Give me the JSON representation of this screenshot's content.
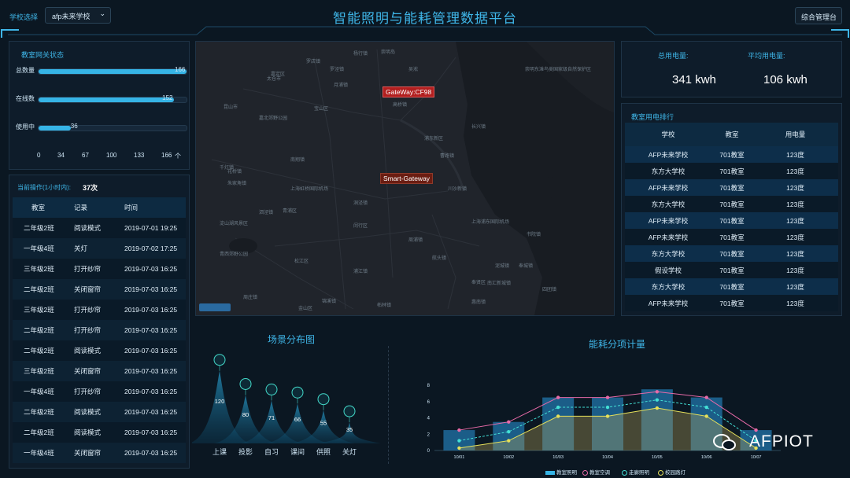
{
  "header": {
    "school_label": "学校选择",
    "school_select": "afp未来学校",
    "title": "智能照明与能耗管理数据平台",
    "admin_button": "综合管理台"
  },
  "gateway_status": {
    "title": "教室网关状态",
    "bars": [
      {
        "label": "总数量",
        "value": 166,
        "fraction": 1.0
      },
      {
        "label": "在线数",
        "value": 152,
        "fraction": 0.9157
      },
      {
        "label": "使用中",
        "value": 36,
        "fraction": 0.2169
      }
    ],
    "ticks": [
      "0",
      "34",
      "67",
      "100",
      "133",
      "166"
    ],
    "unit": "个"
  },
  "operations": {
    "label": "当前操作(1小时内):",
    "count": "37次",
    "columns": [
      "教室",
      "记录",
      "时间"
    ],
    "rows": [
      [
        "二年级2班",
        "阅读模式",
        "2019-07-01 19:25"
      ],
      [
        "一年级4班",
        "关灯",
        "2019-07-02 17:25"
      ],
      [
        "三年级2班",
        "打开纱帘",
        "2019-07-03 16:25"
      ],
      [
        "二年级2班",
        "关闭窗帘",
        "2019-07-03 16:25"
      ],
      [
        "三年级2班",
        "打开纱帘",
        "2019-07-03 16:25"
      ],
      [
        "二年级2班",
        "打开纱帘",
        "2019-07-03 16:25"
      ],
      [
        "二年级2班",
        "阅读模式",
        "2019-07-03 16:25"
      ],
      [
        "三年级2班",
        "关闭窗帘",
        "2019-07-03 16:25"
      ],
      [
        "一年级4班",
        "打开纱帘",
        "2019-07-03 16:25"
      ],
      [
        "二年级2班",
        "阅读模式",
        "2019-07-03 16:25"
      ],
      [
        "二年级2班",
        "阅读模式",
        "2019-07-03 16:25"
      ],
      [
        "一年级4班",
        "关闭窗帘",
        "2019-07-03 16:25"
      ]
    ]
  },
  "map": {
    "gateways": [
      "GateWay:CF98",
      "Smart-Gateway"
    ],
    "labels": [
      "嘉定区",
      "宝山区",
      "太仓市",
      "罗泾镇",
      "月浦镇",
      "昆山市",
      "青浦区",
      "嘉北郊野公园",
      "长兴镇",
      "千灯镇",
      "松江区",
      "闵行区",
      "奉贤区",
      "崇明岛",
      "崇明东滩鸟类国家级自然保护区",
      "上海虹桥国际机场",
      "上海浦东国际机场",
      "金山区",
      "浦东新区",
      "朱家角镇",
      "淀山湖风景区",
      "洞泾镇",
      "青西郊野公园",
      "泗泾镇",
      "川沙新镇",
      "周浦镇",
      "南汇新城镇",
      "惠南镇",
      "浦江镇",
      "吴淞",
      "高桥镇",
      "花桥镇",
      "周庄镇",
      "锦溪镇",
      "罗店镇",
      "杨行镇",
      "南翔镇",
      "曹路镇",
      "航头镇",
      "奉城镇",
      "柘林镇",
      "书院镇",
      "四团镇",
      "泥城镇"
    ]
  },
  "kpi": {
    "total_label": "总用电量:",
    "total_value": "341 kwh",
    "avg_label": "平均用电量:",
    "avg_value": "106 kwh"
  },
  "ranking": {
    "title": "教室用电排行",
    "columns": [
      "学校",
      "教室",
      "用电量"
    ],
    "rows": [
      [
        "AFP未来学校",
        "701教室",
        "123度"
      ],
      [
        "东方大学校",
        "701教室",
        "123度"
      ],
      [
        "AFP未来学校",
        "701教室",
        "123度"
      ],
      [
        "东方大学校",
        "701教室",
        "123度"
      ],
      [
        "AFP未来学校",
        "701教室",
        "123度"
      ],
      [
        "AFP未来学校",
        "701教室",
        "123度"
      ],
      [
        "东方大学校",
        "701教室",
        "123度"
      ],
      [
        "假设学校",
        "701教室",
        "123度"
      ],
      [
        "东方大学校",
        "701教室",
        "123度"
      ],
      [
        "AFP未来学校",
        "701教室",
        "123度"
      ]
    ]
  },
  "colors": {
    "accent": "#3fb6e8",
    "bar": "#36b4e6",
    "pink": "#e86aa8",
    "cyan": "#43e0d6",
    "yellow": "#e6e05a",
    "gold": "#b8a35a"
  },
  "chart_data": [
    {
      "type": "area",
      "title": "场景分布图",
      "categories": [
        "上课",
        "投影",
        "自习",
        "课间",
        "供照",
        "关灯"
      ],
      "values": [
        120,
        80,
        71,
        66,
        55,
        35
      ],
      "icons": [
        "screen-icon",
        "projector-icon",
        "book-icon",
        "moon-icon",
        "lamp-icon",
        "power-icon"
      ]
    },
    {
      "type": "bar",
      "title": "能耗分项计量",
      "categories": [
        "10/01",
        "10/02",
        "10/03",
        "10/04",
        "10/05",
        "10/06",
        "10/07"
      ],
      "ylim": [
        0,
        8
      ],
      "yticks": [
        "0",
        "2",
        "4",
        "6",
        "8"
      ],
      "series": [
        {
          "name": "教室照明",
          "kind": "bar",
          "values": [
            2.5,
            3.5,
            6.5,
            6.5,
            7.5,
            6.5,
            2.5
          ]
        },
        {
          "name": "教室空调",
          "kind": "line",
          "values": [
            2.5,
            3.5,
            6.5,
            6.5,
            7.2,
            6.5,
            2.5
          ]
        },
        {
          "name": "走廊照明",
          "kind": "line",
          "values": [
            1.2,
            2.3,
            5.3,
            5.3,
            6.2,
            5.3,
            1.2
          ]
        },
        {
          "name": "校园路灯",
          "kind": "line",
          "values": [
            0.3,
            1.2,
            4.2,
            4.2,
            5.2,
            4.2,
            0.3
          ]
        }
      ]
    }
  ],
  "watermark": "AFPIOT"
}
